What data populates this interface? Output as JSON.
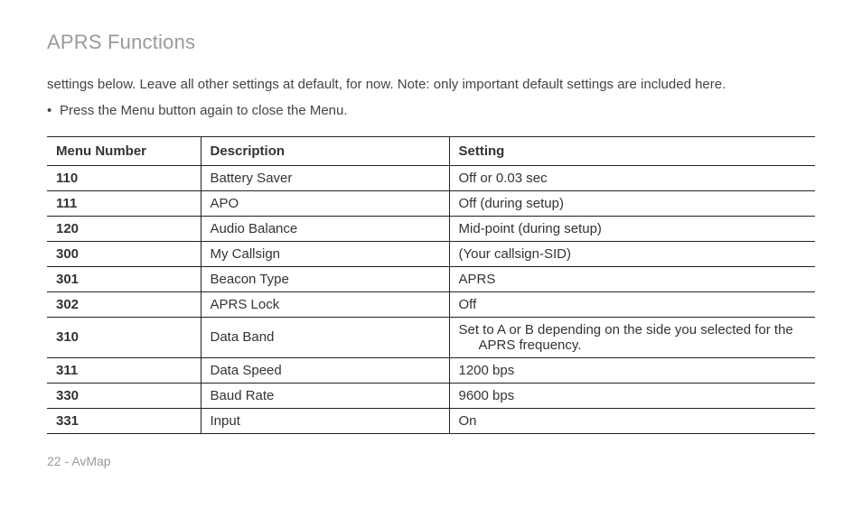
{
  "title": "APRS Functions",
  "intro": "settings below. Leave all other settings at default, for now. Note: only  important default settings are included here.",
  "bullet": "Press the Menu button again to close the Menu.",
  "table": {
    "headers": {
      "menu": "Menu Number",
      "desc": "Description",
      "setting": "Setting"
    },
    "rows": [
      {
        "menu": "110",
        "desc": "Battery Saver",
        "setting": "Off or 0.03 sec"
      },
      {
        "menu": "111",
        "desc": "APO",
        "setting": "Off (during setup)"
      },
      {
        "menu": "120",
        "desc": "Audio Balance",
        "setting": "Mid-point (during setup)"
      },
      {
        "menu": "300",
        "desc": "My Callsign",
        "setting": "(Your callsign-SID)"
      },
      {
        "menu": "301",
        "desc": "Beacon Type",
        "setting": "APRS"
      },
      {
        "menu": "302",
        "desc": "APRS Lock",
        "setting": "Off"
      },
      {
        "menu": "310",
        "desc": "Data Band",
        "setting": "Set to A or B depending on the side you selected for the APRS frequency."
      },
      {
        "menu": "311",
        "desc": "Data Speed",
        "setting": "1200 bps"
      },
      {
        "menu": "330",
        "desc": "Baud Rate",
        "setting": "9600 bps"
      },
      {
        "menu": "331",
        "desc": "Input",
        "setting": "On"
      }
    ]
  },
  "footer": "22 - AvMap"
}
